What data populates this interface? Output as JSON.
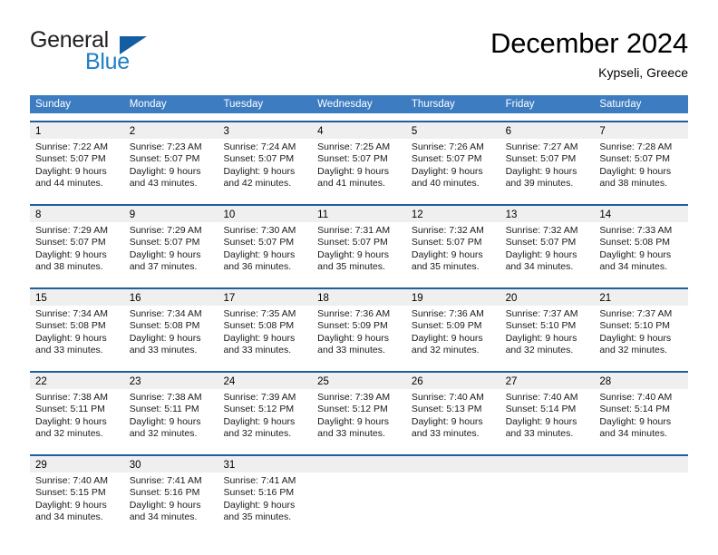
{
  "brand": {
    "word_general": "General",
    "word_blue": "Blue",
    "triangle_color": "#125ea0"
  },
  "header": {
    "month_title": "December 2024",
    "location": "Kypseli, Greece"
  },
  "colors": {
    "header_bar": "#3d7cc0",
    "row_border": "#1f5fa0",
    "day_strip": "#efefef",
    "brand_blue": "#1f7fc4"
  },
  "weekdays": [
    "Sunday",
    "Monday",
    "Tuesday",
    "Wednesday",
    "Thursday",
    "Friday",
    "Saturday"
  ],
  "weeks": [
    [
      {
        "day": "1",
        "sunrise": "Sunrise: 7:22 AM",
        "sunset": "Sunset: 5:07 PM",
        "daylight_1": "Daylight: 9 hours",
        "daylight_2": "and 44 minutes."
      },
      {
        "day": "2",
        "sunrise": "Sunrise: 7:23 AM",
        "sunset": "Sunset: 5:07 PM",
        "daylight_1": "Daylight: 9 hours",
        "daylight_2": "and 43 minutes."
      },
      {
        "day": "3",
        "sunrise": "Sunrise: 7:24 AM",
        "sunset": "Sunset: 5:07 PM",
        "daylight_1": "Daylight: 9 hours",
        "daylight_2": "and 42 minutes."
      },
      {
        "day": "4",
        "sunrise": "Sunrise: 7:25 AM",
        "sunset": "Sunset: 5:07 PM",
        "daylight_1": "Daylight: 9 hours",
        "daylight_2": "and 41 minutes."
      },
      {
        "day": "5",
        "sunrise": "Sunrise: 7:26 AM",
        "sunset": "Sunset: 5:07 PM",
        "daylight_1": "Daylight: 9 hours",
        "daylight_2": "and 40 minutes."
      },
      {
        "day": "6",
        "sunrise": "Sunrise: 7:27 AM",
        "sunset": "Sunset: 5:07 PM",
        "daylight_1": "Daylight: 9 hours",
        "daylight_2": "and 39 minutes."
      },
      {
        "day": "7",
        "sunrise": "Sunrise: 7:28 AM",
        "sunset": "Sunset: 5:07 PM",
        "daylight_1": "Daylight: 9 hours",
        "daylight_2": "and 38 minutes."
      }
    ],
    [
      {
        "day": "8",
        "sunrise": "Sunrise: 7:29 AM",
        "sunset": "Sunset: 5:07 PM",
        "daylight_1": "Daylight: 9 hours",
        "daylight_2": "and 38 minutes."
      },
      {
        "day": "9",
        "sunrise": "Sunrise: 7:29 AM",
        "sunset": "Sunset: 5:07 PM",
        "daylight_1": "Daylight: 9 hours",
        "daylight_2": "and 37 minutes."
      },
      {
        "day": "10",
        "sunrise": "Sunrise: 7:30 AM",
        "sunset": "Sunset: 5:07 PM",
        "daylight_1": "Daylight: 9 hours",
        "daylight_2": "and 36 minutes."
      },
      {
        "day": "11",
        "sunrise": "Sunrise: 7:31 AM",
        "sunset": "Sunset: 5:07 PM",
        "daylight_1": "Daylight: 9 hours",
        "daylight_2": "and 35 minutes."
      },
      {
        "day": "12",
        "sunrise": "Sunrise: 7:32 AM",
        "sunset": "Sunset: 5:07 PM",
        "daylight_1": "Daylight: 9 hours",
        "daylight_2": "and 35 minutes."
      },
      {
        "day": "13",
        "sunrise": "Sunrise: 7:32 AM",
        "sunset": "Sunset: 5:07 PM",
        "daylight_1": "Daylight: 9 hours",
        "daylight_2": "and 34 minutes."
      },
      {
        "day": "14",
        "sunrise": "Sunrise: 7:33 AM",
        "sunset": "Sunset: 5:08 PM",
        "daylight_1": "Daylight: 9 hours",
        "daylight_2": "and 34 minutes."
      }
    ],
    [
      {
        "day": "15",
        "sunrise": "Sunrise: 7:34 AM",
        "sunset": "Sunset: 5:08 PM",
        "daylight_1": "Daylight: 9 hours",
        "daylight_2": "and 33 minutes."
      },
      {
        "day": "16",
        "sunrise": "Sunrise: 7:34 AM",
        "sunset": "Sunset: 5:08 PM",
        "daylight_1": "Daylight: 9 hours",
        "daylight_2": "and 33 minutes."
      },
      {
        "day": "17",
        "sunrise": "Sunrise: 7:35 AM",
        "sunset": "Sunset: 5:08 PM",
        "daylight_1": "Daylight: 9 hours",
        "daylight_2": "and 33 minutes."
      },
      {
        "day": "18",
        "sunrise": "Sunrise: 7:36 AM",
        "sunset": "Sunset: 5:09 PM",
        "daylight_1": "Daylight: 9 hours",
        "daylight_2": "and 33 minutes."
      },
      {
        "day": "19",
        "sunrise": "Sunrise: 7:36 AM",
        "sunset": "Sunset: 5:09 PM",
        "daylight_1": "Daylight: 9 hours",
        "daylight_2": "and 32 minutes."
      },
      {
        "day": "20",
        "sunrise": "Sunrise: 7:37 AM",
        "sunset": "Sunset: 5:10 PM",
        "daylight_1": "Daylight: 9 hours",
        "daylight_2": "and 32 minutes."
      },
      {
        "day": "21",
        "sunrise": "Sunrise: 7:37 AM",
        "sunset": "Sunset: 5:10 PM",
        "daylight_1": "Daylight: 9 hours",
        "daylight_2": "and 32 minutes."
      }
    ],
    [
      {
        "day": "22",
        "sunrise": "Sunrise: 7:38 AM",
        "sunset": "Sunset: 5:11 PM",
        "daylight_1": "Daylight: 9 hours",
        "daylight_2": "and 32 minutes."
      },
      {
        "day": "23",
        "sunrise": "Sunrise: 7:38 AM",
        "sunset": "Sunset: 5:11 PM",
        "daylight_1": "Daylight: 9 hours",
        "daylight_2": "and 32 minutes."
      },
      {
        "day": "24",
        "sunrise": "Sunrise: 7:39 AM",
        "sunset": "Sunset: 5:12 PM",
        "daylight_1": "Daylight: 9 hours",
        "daylight_2": "and 32 minutes."
      },
      {
        "day": "25",
        "sunrise": "Sunrise: 7:39 AM",
        "sunset": "Sunset: 5:12 PM",
        "daylight_1": "Daylight: 9 hours",
        "daylight_2": "and 33 minutes."
      },
      {
        "day": "26",
        "sunrise": "Sunrise: 7:40 AM",
        "sunset": "Sunset: 5:13 PM",
        "daylight_1": "Daylight: 9 hours",
        "daylight_2": "and 33 minutes."
      },
      {
        "day": "27",
        "sunrise": "Sunrise: 7:40 AM",
        "sunset": "Sunset: 5:14 PM",
        "daylight_1": "Daylight: 9 hours",
        "daylight_2": "and 33 minutes."
      },
      {
        "day": "28",
        "sunrise": "Sunrise: 7:40 AM",
        "sunset": "Sunset: 5:14 PM",
        "daylight_1": "Daylight: 9 hours",
        "daylight_2": "and 34 minutes."
      }
    ],
    [
      {
        "day": "29",
        "sunrise": "Sunrise: 7:40 AM",
        "sunset": "Sunset: 5:15 PM",
        "daylight_1": "Daylight: 9 hours",
        "daylight_2": "and 34 minutes."
      },
      {
        "day": "30",
        "sunrise": "Sunrise: 7:41 AM",
        "sunset": "Sunset: 5:16 PM",
        "daylight_1": "Daylight: 9 hours",
        "daylight_2": "and 34 minutes."
      },
      {
        "day": "31",
        "sunrise": "Sunrise: 7:41 AM",
        "sunset": "Sunset: 5:16 PM",
        "daylight_1": "Daylight: 9 hours",
        "daylight_2": "and 35 minutes."
      },
      {
        "day": "",
        "sunrise": "",
        "sunset": "",
        "daylight_1": "",
        "daylight_2": ""
      },
      {
        "day": "",
        "sunrise": "",
        "sunset": "",
        "daylight_1": "",
        "daylight_2": ""
      },
      {
        "day": "",
        "sunrise": "",
        "sunset": "",
        "daylight_1": "",
        "daylight_2": ""
      },
      {
        "day": "",
        "sunrise": "",
        "sunset": "",
        "daylight_1": "",
        "daylight_2": ""
      }
    ]
  ]
}
